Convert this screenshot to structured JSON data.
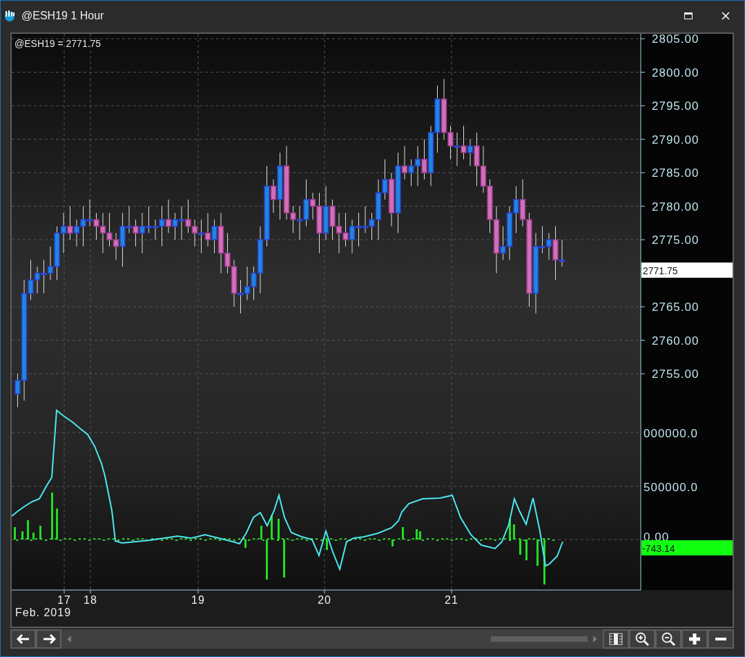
{
  "window": {
    "title": "@ESH19 1 Hour"
  },
  "chart": {
    "quote": "@ESH19 = 2771.75",
    "price_ticks": [
      "2805.00",
      "2800.00",
      "2795.00",
      "2790.00",
      "2785.00",
      "2780.00",
      "2775.00",
      "2765.00",
      "2760.00",
      "2755.00"
    ],
    "price_tag": "2771.75",
    "indicator_ticks": [
      "000000.0",
      "500000.0",
      "0.00"
    ],
    "indicator_tag": "-743.14",
    "date_labels": [
      "17",
      "18",
      "19",
      "20",
      "21"
    ],
    "month_label": "Feb. 2019"
  }
}
